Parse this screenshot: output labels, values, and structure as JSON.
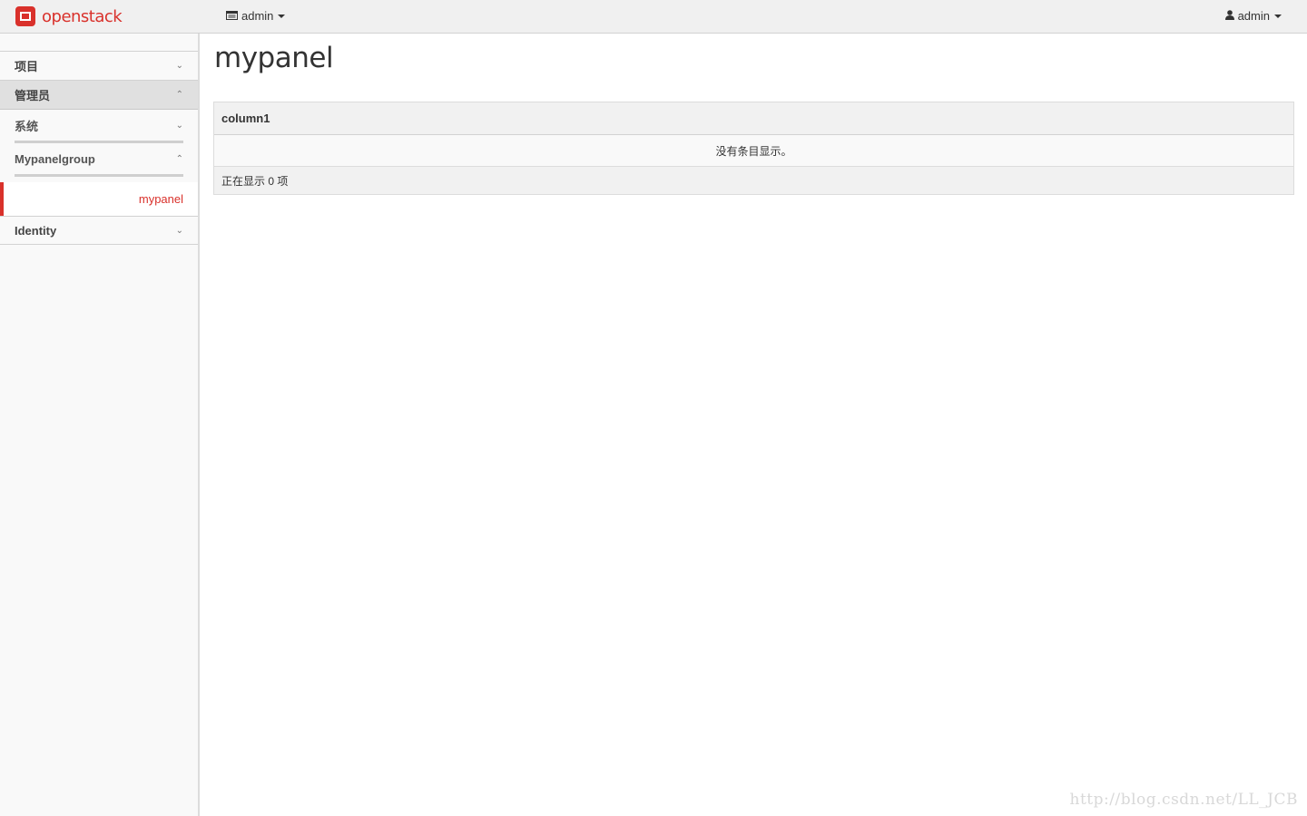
{
  "brand": {
    "name": "openstack",
    "color": "#d9312b",
    "logo_icon": "openstack-logo"
  },
  "header": {
    "project_label": "admin",
    "project_icon": "project-icon",
    "user_label": "admin",
    "user_icon": "user-icon"
  },
  "sidebar": {
    "sections": [
      {
        "label": "项目",
        "state": "collapsed"
      },
      {
        "label": "管理员",
        "state": "expanded"
      }
    ],
    "admin_groups": [
      {
        "label": "系统",
        "state": "collapsed"
      },
      {
        "label": "Mypanelgroup",
        "state": "expanded"
      }
    ],
    "active_item": {
      "label": "mypanel"
    },
    "identity": {
      "label": "Identity",
      "state": "collapsed"
    }
  },
  "main": {
    "title": "mypanel",
    "table": {
      "columns": [
        "column1"
      ],
      "empty_message": "没有条目显示。",
      "footer": "正在显示 0 项"
    }
  },
  "watermark": "http://blog.csdn.net/LL_JCB",
  "colors": {
    "accent": "#d9312b",
    "topbar": "#f0f0f0",
    "sidebar": "#f9f9f9"
  }
}
